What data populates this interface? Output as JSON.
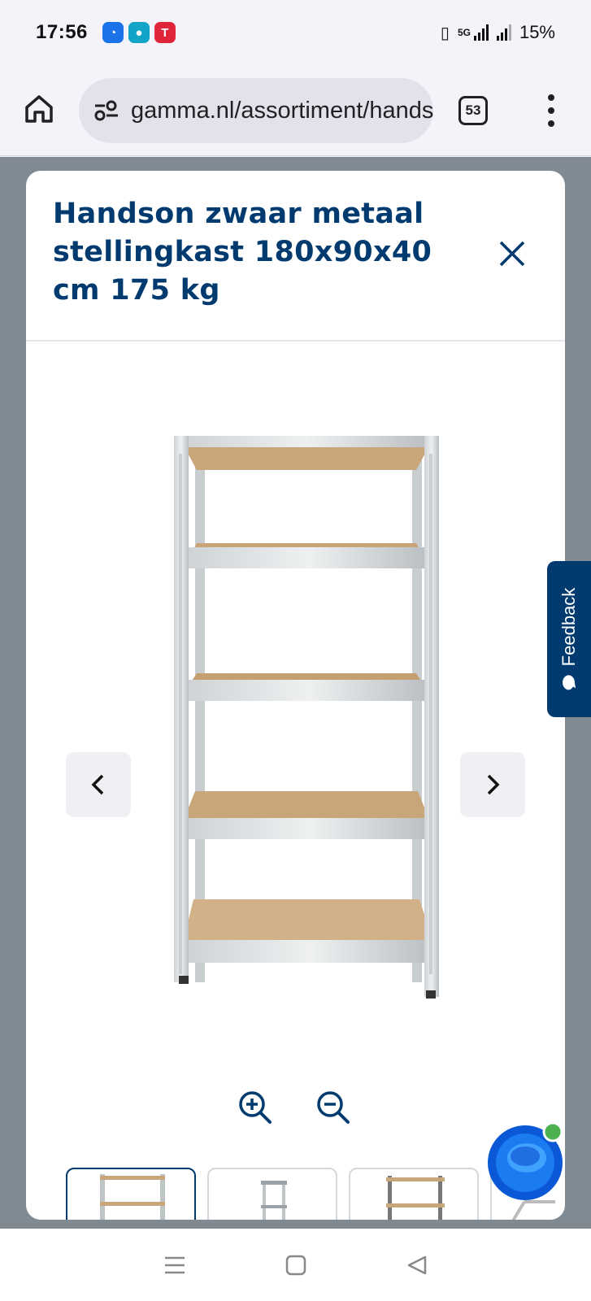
{
  "status_bar": {
    "time": "17:56",
    "network": "5G",
    "battery": "15%"
  },
  "browser": {
    "url": "gamma.nl/assortiment/handson",
    "tab_count": "53"
  },
  "modal": {
    "title": "Handson zwaar metaal stellingkast 180x90x40 cm 175 kg",
    "image_alt": "Metalen stellingkast met 5 planken"
  },
  "feedback": {
    "label": "Feedback"
  },
  "colors": {
    "brand_blue": "#003a6e",
    "overlay": "#7f8a93"
  }
}
